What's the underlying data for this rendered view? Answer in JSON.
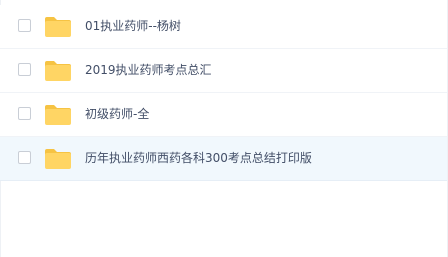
{
  "file_list": {
    "items": [
      {
        "name": "01执业药师--杨树",
        "type": "folder",
        "icon": "folder-icon"
      },
      {
        "name": "2019执业药师考点总汇",
        "type": "folder",
        "icon": "folder-icon"
      },
      {
        "name": "初级药师-全",
        "type": "folder",
        "icon": "folder-icon"
      },
      {
        "name": "历年执业药师西药各科300考点总结打印版",
        "type": "folder",
        "icon": "folder-icon",
        "hovered": true
      }
    ]
  },
  "colors": {
    "folder": "#ffd564",
    "folder_tab": "#f6c343",
    "hover_row": "#f1f8fd",
    "text": "#424e67"
  }
}
